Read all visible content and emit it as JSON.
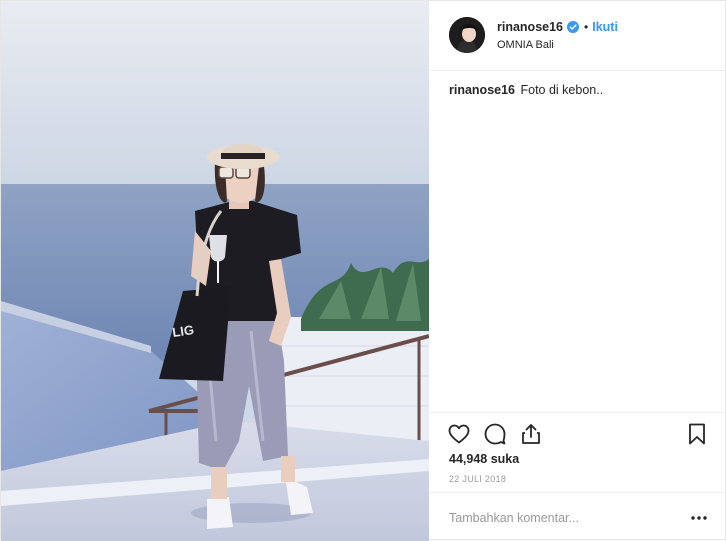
{
  "post": {
    "username": "rinanose16",
    "verified": true,
    "follow_label": "Ikuti",
    "separator": "•",
    "location": "OMNIA Bali",
    "caption": {
      "username": "rinanose16",
      "text": "Foto di kebon.."
    },
    "likes": "44,948 suka",
    "date": "22 JULI 2018",
    "comment_placeholder": "Tambahkan komentar..."
  },
  "icons": {
    "like": "heart-icon",
    "comment": "comment-bubble-icon",
    "share": "share-icon",
    "save": "bookmark-icon",
    "more": "more-options-icon",
    "verified": "verified-badge-icon"
  },
  "colors": {
    "accent": "#3897f0",
    "text": "#262626",
    "muted": "#999999",
    "border": "#efefef"
  }
}
